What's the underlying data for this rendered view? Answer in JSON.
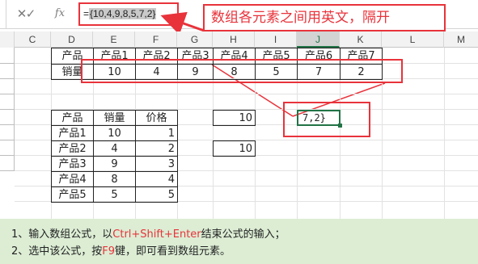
{
  "formula_bar": {
    "cancel_icon": "cross-icon",
    "enter_icon": "check-icon",
    "fx_label": "fx",
    "formula_prefix": "=",
    "formula_value": "{10,4,9,8,5,7,2}"
  },
  "callout": {
    "text": "数组各元素之间用英文，隔开"
  },
  "columns": [
    "C",
    "D",
    "E",
    "F",
    "G",
    "H",
    "I",
    "J",
    "K",
    "L",
    "M"
  ],
  "selected_column": "J",
  "top_table": {
    "header_row": [
      "产品",
      "产品1",
      "产品2",
      "产品3",
      "产品4",
      "产品5",
      "产品6",
      "产品7"
    ],
    "sales_label": "销量",
    "sales_values": [
      "10",
      "4",
      "9",
      "8",
      "5",
      "7",
      "2"
    ]
  },
  "h_cells": [
    "10",
    "10"
  ],
  "j_cell_value": "7,2}",
  "bottom_table": {
    "headers": [
      "产品",
      "销量",
      "价格"
    ],
    "rows": [
      [
        "产品1",
        "10",
        "1"
      ],
      [
        "产品2",
        "4",
        "2"
      ],
      [
        "产品3",
        "9",
        "3"
      ],
      [
        "产品4",
        "8",
        "4"
      ],
      [
        "产品5",
        "5",
        "5"
      ]
    ]
  },
  "tips": {
    "line1_a": "1、输入数组公式，以",
    "line1_key": "Ctrl+Shift+Enter",
    "line1_b": "结束公式的输入；",
    "line2_a": "2、选中该公式，按",
    "line2_key": "F9",
    "line2_b": "键，即可看到数组元素。"
  },
  "colors": {
    "accent_red": "#e8333b",
    "tip_bg": "#dcedd4",
    "excel_green": "#217346"
  }
}
